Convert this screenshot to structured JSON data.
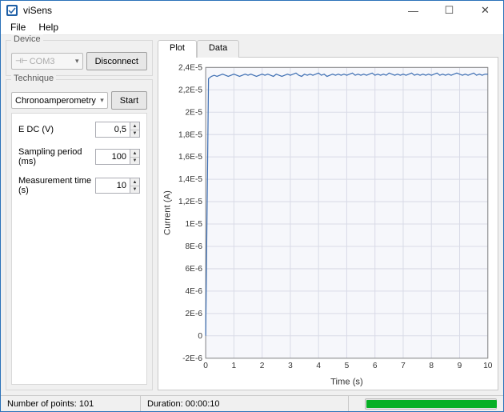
{
  "window": {
    "title": "viSens"
  },
  "menu": {
    "file": "File",
    "help": "Help"
  },
  "titlebar_buttons": {
    "minimize": "—",
    "maximize": "☐",
    "close": "✕"
  },
  "device": {
    "legend": "Device",
    "port": "COM3",
    "disconnect_button": "Disconnect"
  },
  "technique": {
    "legend": "Technique",
    "name": "Chronoamperometry",
    "start_button": "Start",
    "params": {
      "edc_label": "E DC (V)",
      "edc_value": "0,5",
      "sampling_label": "Sampling period (ms)",
      "sampling_value": "100",
      "meas_label": "Measurement time (s)",
      "meas_value": "10"
    }
  },
  "tabs": {
    "plot": "Plot",
    "data": "Data"
  },
  "status": {
    "points_label": "Number of points:",
    "points_value": "101",
    "duration_label": "Duration:",
    "duration_value": "00:00:10",
    "progress_pct": 100
  },
  "chart_data": {
    "type": "line",
    "title": "",
    "xlabel": "Time (s)",
    "ylabel": "Current (A)",
    "xlim": [
      0,
      10
    ],
    "ylim": [
      -2e-06,
      2.4e-05
    ],
    "x_ticks": [
      0,
      1,
      2,
      3,
      4,
      5,
      6,
      7,
      8,
      9,
      10
    ],
    "y_ticks": [
      {
        "v": -2e-06,
        "label": "-2E-6"
      },
      {
        "v": 0,
        "label": "0"
      },
      {
        "v": 2e-06,
        "label": "2E-6"
      },
      {
        "v": 4e-06,
        "label": "4E-6"
      },
      {
        "v": 6e-06,
        "label": "6E-6"
      },
      {
        "v": 8e-06,
        "label": "8E-6"
      },
      {
        "v": 1e-05,
        "label": "1E-5"
      },
      {
        "v": 1.2e-05,
        "label": "1,2E-5"
      },
      {
        "v": 1.4e-05,
        "label": "1,4E-5"
      },
      {
        "v": 1.6e-05,
        "label": "1,6E-5"
      },
      {
        "v": 1.8e-05,
        "label": "1,8E-5"
      },
      {
        "v": 2e-05,
        "label": "2E-5"
      },
      {
        "v": 2.2e-05,
        "label": "2,2E-5"
      },
      {
        "v": 2.4e-05,
        "label": "2,4E-5"
      }
    ],
    "x": [
      0,
      0.1,
      0.2,
      0.3,
      0.4,
      0.5,
      0.6,
      0.7,
      0.8,
      0.9,
      1,
      1.1,
      1.2,
      1.3,
      1.4,
      1.5,
      1.6,
      1.7,
      1.8,
      1.9,
      2,
      2.1,
      2.2,
      2.3,
      2.4,
      2.5,
      2.6,
      2.7,
      2.8,
      2.9,
      3,
      3.1,
      3.2,
      3.3,
      3.4,
      3.5,
      3.6,
      3.7,
      3.8,
      3.9,
      4,
      4.1,
      4.2,
      4.3,
      4.4,
      4.5,
      4.6,
      4.7,
      4.8,
      4.9,
      5,
      5.1,
      5.2,
      5.3,
      5.4,
      5.5,
      5.6,
      5.7,
      5.8,
      5.9,
      6,
      6.1,
      6.2,
      6.3,
      6.4,
      6.5,
      6.6,
      6.7,
      6.8,
      6.9,
      7,
      7.1,
      7.2,
      7.3,
      7.4,
      7.5,
      7.6,
      7.7,
      7.8,
      7.9,
      8,
      8.1,
      8.2,
      8.3,
      8.4,
      8.5,
      8.6,
      8.7,
      8.8,
      8.9,
      9,
      9.1,
      9.2,
      9.3,
      9.4,
      9.5,
      9.6,
      9.7,
      9.8,
      9.9,
      10
    ],
    "y": [
      0,
      2.3e-05,
      2.32e-05,
      2.33e-05,
      2.32e-05,
      2.33e-05,
      2.34e-05,
      2.33e-05,
      2.32e-05,
      2.33e-05,
      2.34e-05,
      2.33e-05,
      2.32e-05,
      2.33e-05,
      2.34e-05,
      2.33e-05,
      2.34e-05,
      2.33e-05,
      2.32e-05,
      2.33e-05,
      2.34e-05,
      2.33e-05,
      2.34e-05,
      2.33e-05,
      2.32e-05,
      2.34e-05,
      2.33e-05,
      2.32e-05,
      2.33e-05,
      2.34e-05,
      2.33e-05,
      2.34e-05,
      2.35e-05,
      2.33e-05,
      2.32e-05,
      2.34e-05,
      2.33e-05,
      2.34e-05,
      2.33e-05,
      2.34e-05,
      2.35e-05,
      2.33e-05,
      2.34e-05,
      2.32e-05,
      2.33e-05,
      2.34e-05,
      2.33e-05,
      2.34e-05,
      2.33e-05,
      2.34e-05,
      2.33e-05,
      2.34e-05,
      2.35e-05,
      2.33e-05,
      2.34e-05,
      2.33e-05,
      2.34e-05,
      2.33e-05,
      2.34e-05,
      2.35e-05,
      2.33e-05,
      2.34e-05,
      2.33e-05,
      2.34e-05,
      2.33e-05,
      2.35e-05,
      2.34e-05,
      2.33e-05,
      2.34e-05,
      2.33e-05,
      2.34e-05,
      2.33e-05,
      2.34e-05,
      2.35e-05,
      2.33e-05,
      2.34e-05,
      2.33e-05,
      2.34e-05,
      2.33e-05,
      2.34e-05,
      2.33e-05,
      2.34e-05,
      2.35e-05,
      2.33e-05,
      2.34e-05,
      2.33e-05,
      2.34e-05,
      2.33e-05,
      2.34e-05,
      2.35e-05,
      2.34e-05,
      2.33e-05,
      2.34e-05,
      2.33e-05,
      2.34e-05,
      2.35e-05,
      2.33e-05,
      2.34e-05,
      2.33e-05,
      2.34e-05,
      2.34e-05
    ]
  }
}
